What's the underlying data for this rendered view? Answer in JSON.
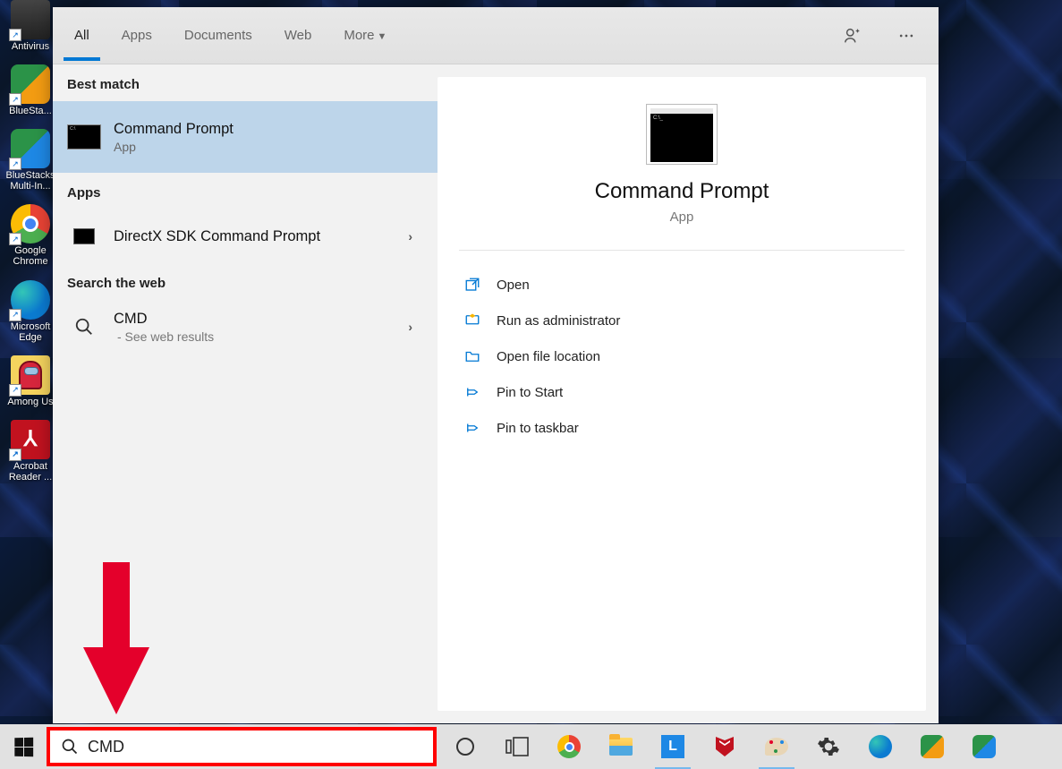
{
  "desktop_icons": [
    {
      "label": "Antivirus",
      "color": "#222"
    },
    {
      "label": "BlueSta...",
      "color": "#2b9348,#f39c12"
    },
    {
      "label": "BlueStacks Multi-In...",
      "color": "#2b9348,#1e88e5"
    },
    {
      "label": "Google Chrome",
      "color_ring": true
    },
    {
      "label": "Microsoft Edge",
      "color": "#0b7bd1"
    },
    {
      "label": "Among Us",
      "color": "#d7263d,#f4d35e"
    },
    {
      "label": "Acrobat Reader ...",
      "color": "#c1121f"
    }
  ],
  "tabs": {
    "all": "All",
    "apps": "Apps",
    "documents": "Documents",
    "web": "Web",
    "more": "More"
  },
  "sections": {
    "best_match": "Best match",
    "apps": "Apps",
    "search_web": "Search the web"
  },
  "best_match": {
    "title": "Command Prompt",
    "sub": "App"
  },
  "apps_result": {
    "title": "DirectX SDK Command Prompt"
  },
  "web_result": {
    "title": "CMD",
    "sub": "- See web results"
  },
  "detail": {
    "title": "Command Prompt",
    "sub": "App",
    "actions": {
      "open": "Open",
      "runadmin": "Run as administrator",
      "openloc": "Open file location",
      "pinstart": "Pin to Start",
      "pintask": "Pin to taskbar"
    }
  },
  "search": {
    "value": "CMD"
  }
}
